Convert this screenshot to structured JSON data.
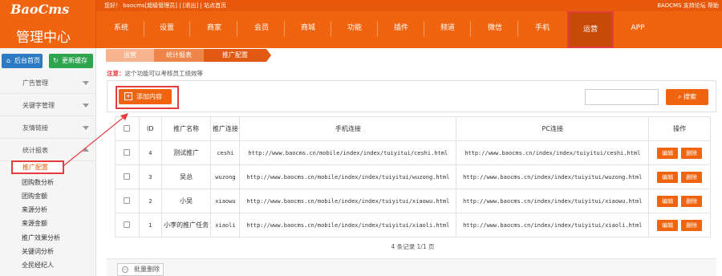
{
  "header": {
    "logo": "BaoCms",
    "subtitle": "管理中心",
    "topbar_left": "您好！ baocms[超级管理员] | [退出] | 站点首页",
    "topbar_right": "BAOCMS 支持论坛 帮助",
    "nav": [
      "系统",
      "设置",
      "商家",
      "会员",
      "商城",
      "功能",
      "插件",
      "频道",
      "微信",
      "手机",
      "运营",
      "APP"
    ],
    "nav_active": "运营",
    "accent": "#f0640f"
  },
  "sidebar": {
    "home_btn": "后台首页",
    "cache_btn": "更新缓存",
    "groups": [
      "广告管理",
      "关键字管理",
      "友情链接",
      "统计报表"
    ],
    "items": [
      "推广配置",
      "团购数分析",
      "团购金额",
      "来源分析",
      "来源金额",
      "推广效果分析",
      "关键词分析",
      "全民经纪人"
    ],
    "active_item": "推广配置"
  },
  "breadcrumb": [
    "运营",
    "统计报表",
    "推广配置"
  ],
  "notice": {
    "label": "注意：",
    "text": "这个功能可以考核员工绩效等"
  },
  "toolbar": {
    "add_label": "添加内容",
    "search_label": "搜索",
    "search_value": ""
  },
  "table": {
    "headers": [
      "ID",
      "推广名称",
      "推广连接",
      "手机连接",
      "PC连接",
      "操作"
    ],
    "rows": [
      {
        "id": "4",
        "name": "测试推广",
        "code": "ceshi",
        "mobile": "http://www.baocms.cn/mobile/index/index/tuiyitui/ceshi.html",
        "pc": "http://www.baocms.cn/index/index/tuiyitui/ceshi.html"
      },
      {
        "id": "3",
        "name": "吴总",
        "code": "wuzong",
        "mobile": "http://www.baocms.cn/mobile/index/index/tuiyitui/wuzong.html",
        "pc": "http://www.baocms.cn/index/index/tuiyitui/wuzong.html"
      },
      {
        "id": "2",
        "name": "小吴",
        "code": "xiaowu",
        "mobile": "http://www.baocms.cn/mobile/index/index/tuiyitui/xiaowu.html",
        "pc": "http://www.baocms.cn/index/index/tuiyitui/xiaowu.html"
      },
      {
        "id": "1",
        "name": "小李的推广任务",
        "code": "xiaoli",
        "mobile": "http://www.baocms.cn/mobile/index/index/tuiyitui/xiaoli.html",
        "pc": "http://www.baocms.cn/index/index/tuiyitui/xiaoli.html"
      }
    ],
    "edit_label": "编辑",
    "delete_label": "删除"
  },
  "pager": "4 条记录 1/1 页",
  "batch_delete": "批量删除"
}
